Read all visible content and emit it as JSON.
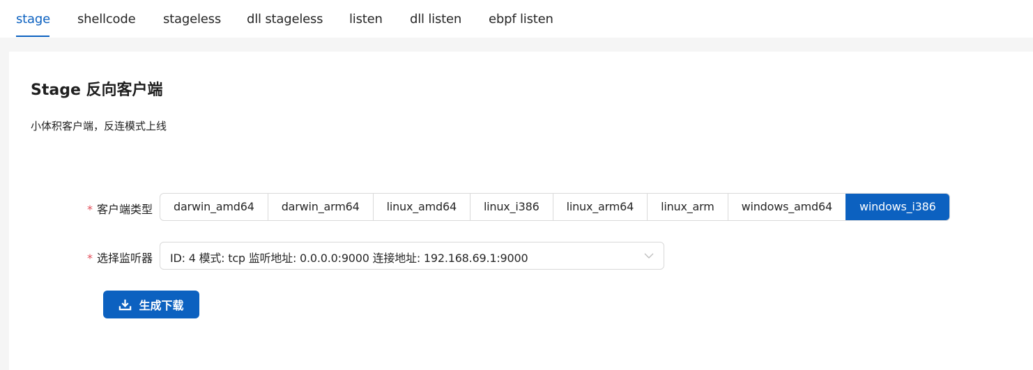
{
  "tabs": [
    {
      "label": "stage",
      "active": true
    },
    {
      "label": "shellcode"
    },
    {
      "label": "stageless"
    },
    {
      "label": "dll stageless"
    },
    {
      "label": "listen"
    },
    {
      "label": "dll listen"
    },
    {
      "label": "ebpf listen"
    }
  ],
  "page": {
    "title": "Stage 反向客户端",
    "description": "小体积客户端，反连模式上线"
  },
  "form": {
    "client_type": {
      "required_mark": "*",
      "label": "客户端类型",
      "options": [
        "darwin_amd64",
        "darwin_arm64",
        "linux_amd64",
        "linux_i386",
        "linux_arm64",
        "linux_arm",
        "windows_amd64",
        "windows_i386"
      ],
      "selected": "windows_i386"
    },
    "listener": {
      "required_mark": "*",
      "label": "选择监听器",
      "value": "ID: 4 模式: tcp 监听地址: 0.0.0.0:9000 连接地址: 192.168.69.1:9000",
      "icon": "chevron-down-icon"
    },
    "submit": {
      "label": "生成下载",
      "icon": "download-icon"
    }
  },
  "colors": {
    "accent": "#0c61c0",
    "required": "#e34d59"
  }
}
